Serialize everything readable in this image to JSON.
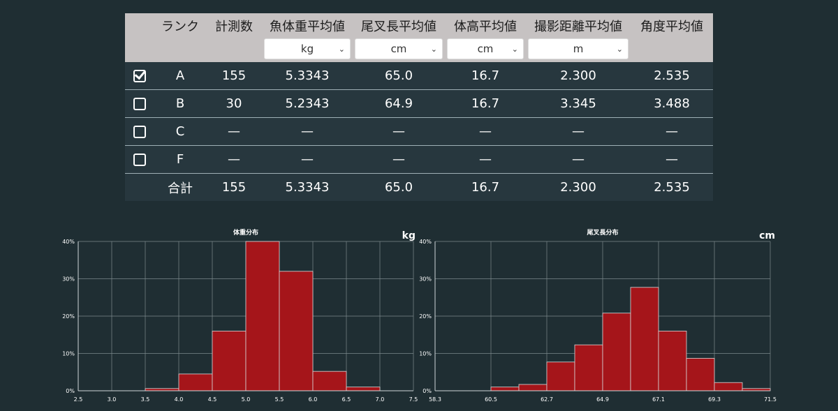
{
  "table": {
    "headers": [
      "",
      "ランク",
      "計測数",
      "魚体重平均値",
      "尾叉長平均値",
      "体高平均値",
      "撮影距離平均値",
      "角度平均値"
    ],
    "units": [
      "kg",
      "cm",
      "cm",
      "m"
    ],
    "rows": [
      {
        "checked": true,
        "rank": "A",
        "count": "155",
        "weight": "5.3343",
        "fork_length": "65.0",
        "height": "16.7",
        "distance": "2.300",
        "angle": "2.535"
      },
      {
        "checked": false,
        "rank": "B",
        "count": "30",
        "weight": "5.2343",
        "fork_length": "64.9",
        "height": "16.7",
        "distance": "3.345",
        "angle": "3.488"
      },
      {
        "checked": false,
        "rank": "C",
        "count": "—",
        "weight": "—",
        "fork_length": "—",
        "height": "—",
        "distance": "—",
        "angle": "—"
      },
      {
        "checked": false,
        "rank": "F",
        "count": "—",
        "weight": "—",
        "fork_length": "—",
        "height": "—",
        "distance": "—",
        "angle": "—"
      }
    ],
    "total": {
      "label": "合計",
      "count": "155",
      "weight": "5.3343",
      "fork_length": "65.0",
      "height": "16.7",
      "distance": "2.300",
      "angle": "2.535"
    }
  },
  "colors": {
    "bar": "#a5151a",
    "bar_stroke": "#d8d8d8",
    "grid": "#7d8a8e",
    "background": "#1f2e33"
  },
  "chart_data": [
    {
      "type": "bar",
      "title": "体重分布",
      "unit": "kg",
      "x_ticks": [
        "2.5",
        "3.0",
        "3.5",
        "4.0",
        "4.5",
        "5.0",
        "5.5",
        "6.0",
        "6.5",
        "7.0",
        "7.5"
      ],
      "y_ticks": [
        "0%",
        "10%",
        "20%",
        "30%",
        "40%"
      ],
      "ylim": [
        0,
        40
      ],
      "xlim": [
        2.5,
        7.5
      ],
      "bins": [
        {
          "from": 3.5,
          "to": 4.0,
          "value": 0.6
        },
        {
          "from": 4.0,
          "to": 4.5,
          "value": 4.5
        },
        {
          "from": 4.5,
          "to": 5.0,
          "value": 16.0
        },
        {
          "from": 5.0,
          "to": 5.5,
          "value": 40.0
        },
        {
          "from": 5.5,
          "to": 6.0,
          "value": 32.0
        },
        {
          "from": 6.0,
          "to": 6.5,
          "value": 5.2
        },
        {
          "from": 6.5,
          "to": 7.0,
          "value": 1.0
        }
      ]
    },
    {
      "type": "bar",
      "title": "尾叉長分布",
      "unit": "cm",
      "x_ticks": [
        "58.3",
        "60.5",
        "62.7",
        "64.9",
        "67.1",
        "69.3",
        "71.5"
      ],
      "y_ticks": [
        "0%",
        "10%",
        "20%",
        "30%",
        "40%"
      ],
      "ylim": [
        0,
        40
      ],
      "xlim": [
        58.3,
        71.5
      ],
      "bins": [
        {
          "from": 60.5,
          "to": 61.6,
          "value": 1.0
        },
        {
          "from": 61.6,
          "to": 62.7,
          "value": 1.7
        },
        {
          "from": 62.7,
          "to": 63.8,
          "value": 7.7
        },
        {
          "from": 63.8,
          "to": 64.9,
          "value": 12.3
        },
        {
          "from": 64.9,
          "to": 66.0,
          "value": 20.8
        },
        {
          "from": 66.0,
          "to": 67.1,
          "value": 27.7
        },
        {
          "from": 67.1,
          "to": 68.2,
          "value": 16.0
        },
        {
          "from": 68.2,
          "to": 69.3,
          "value": 8.7
        },
        {
          "from": 69.3,
          "to": 70.4,
          "value": 2.2
        },
        {
          "from": 70.4,
          "to": 71.5,
          "value": 0.6
        }
      ]
    }
  ]
}
